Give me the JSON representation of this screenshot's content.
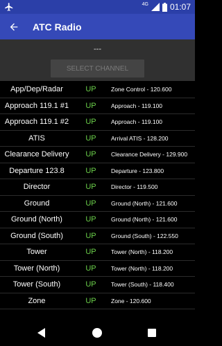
{
  "status_bar": {
    "network": "4G",
    "time": "01:07"
  },
  "app_bar": {
    "title": "ATC Radio"
  },
  "header": {
    "channel_status": "---",
    "select_button": "SELECT CHANNEL"
  },
  "channels": [
    {
      "name": "App/Dep/Radar",
      "state": "UP",
      "desc": "Zone Control - 120.600"
    },
    {
      "name": "Approach 119.1 #1",
      "state": "UP",
      "desc": "Approach - 119.100"
    },
    {
      "name": "Approach 119.1 #2",
      "state": "UP",
      "desc": "Approach - 119.100"
    },
    {
      "name": "ATIS",
      "state": "UP",
      "desc": "Arrival ATIS - 128.200"
    },
    {
      "name": "Clearance Delivery",
      "state": "UP",
      "desc": "Clearance Delivery - 129.900"
    },
    {
      "name": "Departure 123.8",
      "state": "UP",
      "desc": "Departure - 123.800"
    },
    {
      "name": "Director",
      "state": "UP",
      "desc": "Director - 119.500"
    },
    {
      "name": "Ground",
      "state": "UP",
      "desc": "Ground (North) - 121.600"
    },
    {
      "name": "Ground (North)",
      "state": "UP",
      "desc": "Ground (North) - 121.600"
    },
    {
      "name": "Ground (South)",
      "state": "UP",
      "desc": "Ground (South) - 122.550"
    },
    {
      "name": "Tower",
      "state": "UP",
      "desc": "Tower (North) - 118.200"
    },
    {
      "name": "Tower (North)",
      "state": "UP",
      "desc": "Tower (North) - 118.200"
    },
    {
      "name": "Tower (South)",
      "state": "UP",
      "desc": "Tower (South) - 118.400"
    },
    {
      "name": "Zone",
      "state": "UP",
      "desc": "Zone - 120.600"
    }
  ],
  "colors": {
    "status_bar": "#2b3fa8",
    "app_bar": "#3549b8",
    "header_panel": "#303030",
    "up_state": "#6cd14b"
  },
  "icons": {
    "status_left": "airplane-icon",
    "status_right": [
      "signal-icon",
      "battery-icon"
    ],
    "app_bar": "back-arrow-icon",
    "nav": [
      "nav-back-icon",
      "nav-home-icon",
      "nav-recent-icon"
    ]
  }
}
